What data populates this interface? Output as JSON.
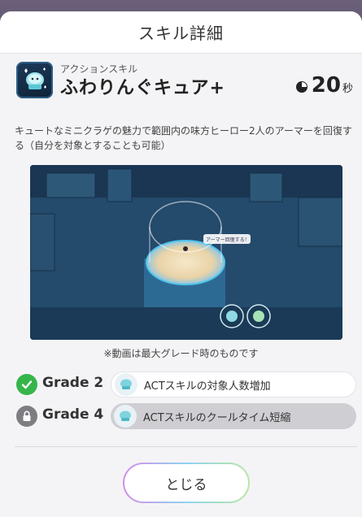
{
  "dialog": {
    "title": "スキル詳細"
  },
  "skill": {
    "type_label": "アクションスキル",
    "name": "ふわりんぐキュア+",
    "cooldown_value": "20",
    "cooldown_unit": "秒",
    "icon": "healing-jellyfish-icon",
    "description": "キュートなミニクラゲの魅力で範囲内の味方ヒーロー2人のアーマーを回復する（自分を対象とすることも可能）"
  },
  "video": {
    "label": "アーマー回復する！",
    "note": "※動画は最大グレード時のものです"
  },
  "grades": [
    {
      "label": "Grade 2",
      "status": "unlocked",
      "status_icon": "check-icon",
      "effect": "ACTスキルの対象人数増加"
    },
    {
      "label": "Grade 4",
      "status": "locked",
      "status_icon": "lock-icon",
      "effect": "ACTスキルのクールタイム短縮"
    }
  ],
  "actions": {
    "close_label": "とじる"
  },
  "colors": {
    "unlocked": "#35b54a",
    "locked": "#7d7d82",
    "accent_cyan": "#3fb8e6"
  }
}
